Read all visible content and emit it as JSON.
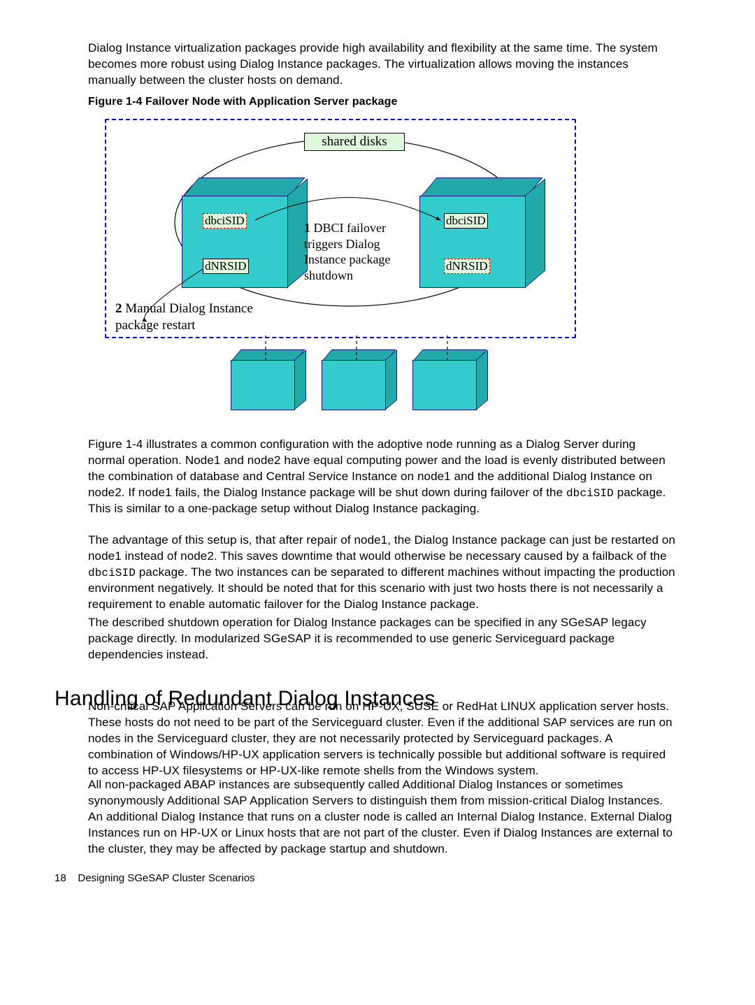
{
  "intro": "Dialog Instance virtualization packages provide high availability and flexibility at the same time. The system becomes more robust using Dialog Instance packages. The virtualization allows moving the instances manually between the cluster hosts on demand.",
  "figure": {
    "caption": "Figure 1-4 Failover Node with Application Server package",
    "shared_label": "shared disks",
    "left_pkg_top": "dbciSID",
    "left_pkg_bot": "dNRSID",
    "right_pkg_top": "dbciSID",
    "right_pkg_bot": "dNRSID",
    "center_num": "1",
    "center_text": "DBCI failover triggers Dialog Instance package shutdown",
    "manual_num": "2",
    "manual_text": "Manual Dialog Instance package restart"
  },
  "p2a": "Figure 1-4 illustrates a common configuration with the adoptive node running as a Dialog Server during normal operation. Node1 and node2 have equal computing power and the load is evenly distributed between the combination of database and Central Service Instance on node1 and the additional Dialog Instance on node2. If node1 fails, the Dialog Instance package will be shut down during failover of the ",
  "p2code": "dbciSID",
  "p2b": " package. This is similar to a one-package setup without Dialog Instance packaging.",
  "p3a": "The advantage of this setup is, that after repair of node1, the Dialog Instance package can just be restarted on node1 instead of node2. This saves downtime that would otherwise be necessary caused by a failback of the ",
  "p3code": "dbciSID",
  "p3b": " package. The two instances can be separated to different machines without impacting the production environment negatively. It should be noted that for this scenario with just two hosts there is not necessarily a requirement to enable automatic failover for the Dialog Instance package.",
  "p4": "The described shutdown operation for Dialog Instance packages can be specified in any SGeSAP legacy package directly. In modularized SGeSAP it is recommended to use generic Serviceguard package dependencies instead.",
  "h2": "Handling of Redundant Dialog Instances",
  "p5": "Non-critical SAP Application Servers can be run on HP-UX, SUSE or RedHat LINUX application server hosts. These hosts do not need to be part of the Serviceguard cluster. Even if the additional SAP services are run on nodes in the Serviceguard cluster, they are not necessarily protected by Serviceguard packages. A combination of Windows/HP-UX application servers is technically possible but additional software is required to access HP-UX filesystems or HP-UX-like remote shells from the Windows system.",
  "p6": "All non-packaged ABAP instances are subsequently called Additional Dialog Instances or sometimes synonymously Additional SAP Application Servers to distinguish them from mission-critical Dialog Instances. An additional Dialog Instance that runs on a cluster node is called an Internal Dialog Instance. External Dialog Instances run on HP-UX or Linux hosts that are not part of the cluster. Even if Dialog Instances are external to the cluster, they may be affected by package startup and shutdown.",
  "footer_pgnum": "18",
  "footer_title": "Designing SGeSAP Cluster Scenarios"
}
